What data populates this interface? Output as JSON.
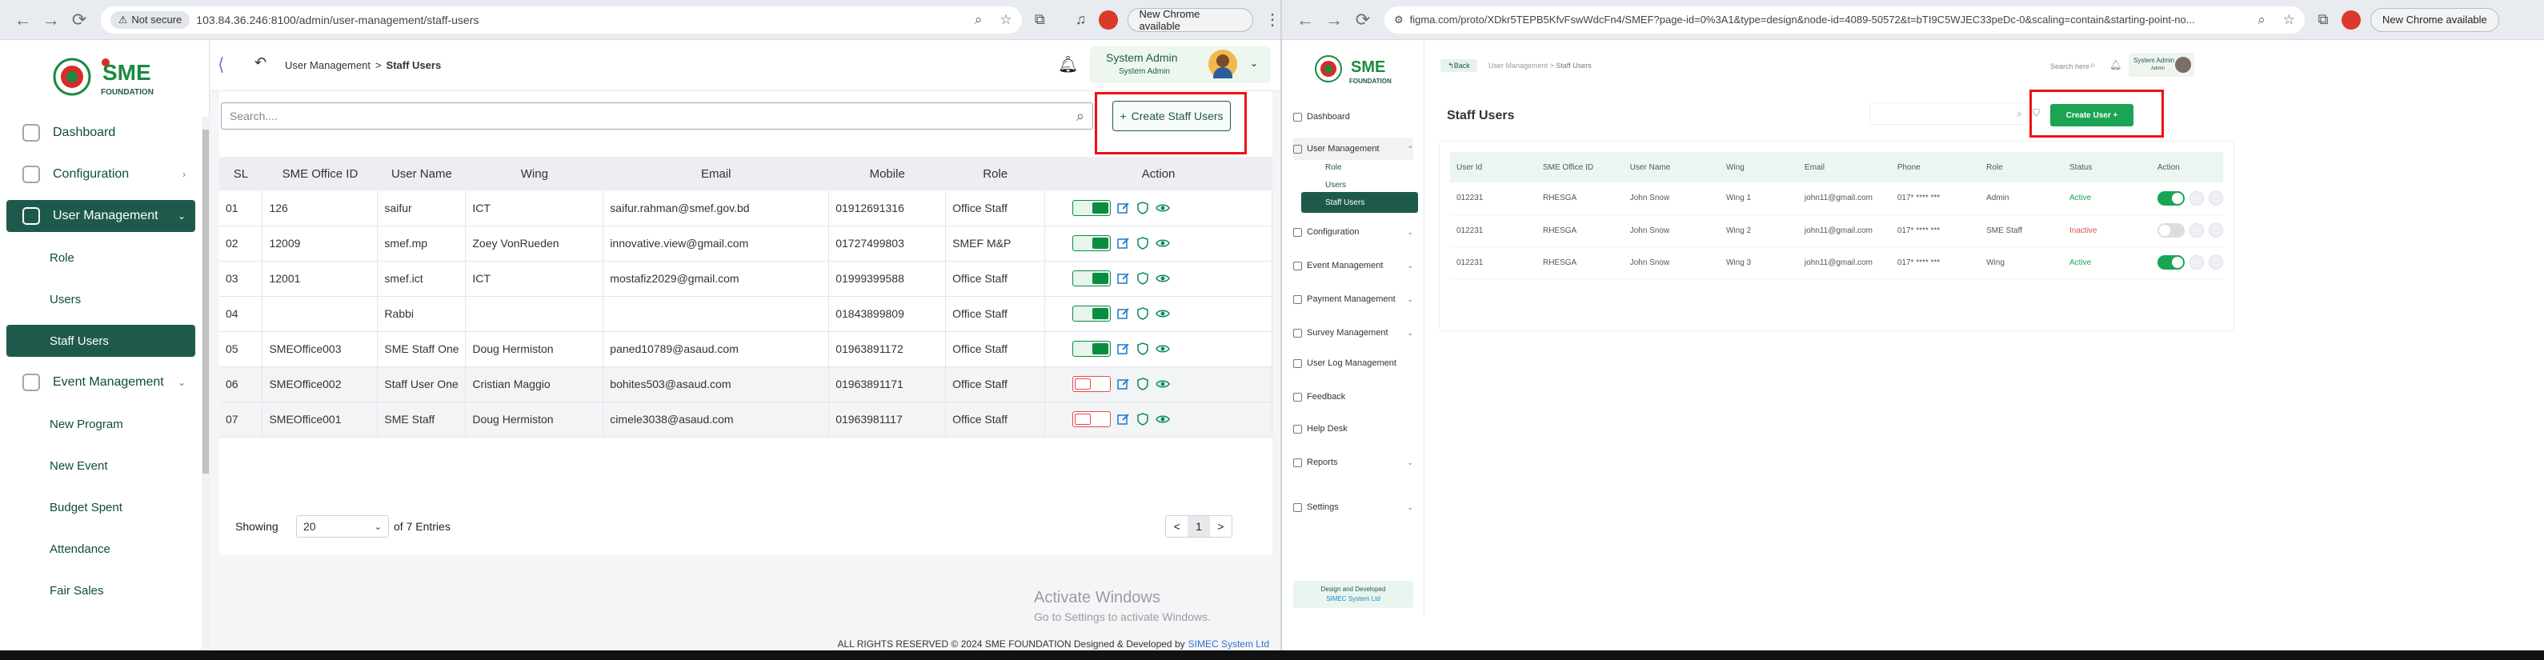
{
  "left_browser": {
    "not_secure": "Not secure",
    "url": "103.84.36.246:8100/admin/user-management/staff-users",
    "update_button": "New Chrome available"
  },
  "right_browser": {
    "url": "figma.com/proto/XDkr5TEPB5KfvFswWdcFn4/SMEF?page-id=0%3A1&type=design&node-id=4089-50572&t=bTI9C5WJEC33peDc-0&scaling=contain&starting-point-no...",
    "update_button": "New Chrome available"
  },
  "app": {
    "logo_text": "SME",
    "logo_sub": "FOUNDATION",
    "breadcrumb": {
      "parent": "User Management",
      "sep": ">",
      "current": "Staff Users"
    },
    "user": {
      "name": "System Admin",
      "role": "System Admin"
    },
    "sidebar": [
      {
        "label": "Dashboard",
        "type": "item"
      },
      {
        "label": "Configuration",
        "type": "item",
        "chevron": "›"
      },
      {
        "label": "User Management",
        "type": "item",
        "chevron": "⌄",
        "active": true
      },
      {
        "label": "Role",
        "type": "sub"
      },
      {
        "label": "Users",
        "type": "sub"
      },
      {
        "label": "Staff Users",
        "type": "sub",
        "active": true
      },
      {
        "label": "Event Management",
        "type": "item",
        "chevron": "⌄"
      },
      {
        "label": "New Program",
        "type": "sub"
      },
      {
        "label": "New Event",
        "type": "sub"
      },
      {
        "label": "Budget Spent",
        "type": "sub"
      },
      {
        "label": "Attendance",
        "type": "sub"
      },
      {
        "label": "Fair Sales",
        "type": "sub"
      }
    ],
    "search_placeholder": "Search....",
    "create_button": "Create Staff Users",
    "table": {
      "headers": [
        "SL",
        "SME Office ID",
        "User Name",
        "Wing",
        "Email",
        "Mobile",
        "Role",
        "Action"
      ],
      "rows": [
        {
          "sl": "01",
          "office_id": "126",
          "user_name": "saifur",
          "wing": "ICT",
          "email": "saifur.rahman@smef.gov.bd",
          "mobile": "01912691316",
          "role": "Office Staff",
          "active": true
        },
        {
          "sl": "02",
          "office_id": "12009",
          "user_name": "smef.mp",
          "wing": "Zoey VonRueden",
          "email": "innovative.view@gmail.com",
          "mobile": "01727499803",
          "role": "SMEF M&P",
          "active": true
        },
        {
          "sl": "03",
          "office_id": "12001",
          "user_name": "smef.ict",
          "wing": "ICT",
          "email": "mostafiz2029@gmail.com",
          "mobile": "01999399588",
          "role": "Office Staff",
          "active": true
        },
        {
          "sl": "04",
          "office_id": "",
          "user_name": "Rabbi",
          "wing": "",
          "email": "",
          "mobile": "01843899809",
          "role": "Office Staff",
          "active": true
        },
        {
          "sl": "05",
          "office_id": "SMEOffice003",
          "user_name": "SME Staff One",
          "wing": "Doug Hermiston",
          "email": "paned10789@asaud.com",
          "mobile": "01963891172",
          "role": "Office Staff",
          "active": true
        },
        {
          "sl": "06",
          "office_id": "SMEOffice002",
          "user_name": "Staff User One",
          "wing": "Cristian Maggio",
          "email": "bohites503@asaud.com",
          "mobile": "01963891171",
          "role": "Office Staff",
          "active": false
        },
        {
          "sl": "07",
          "office_id": "SMEOffice001",
          "user_name": "SME Staff",
          "wing": "Doug Hermiston",
          "email": "cimele3038@asaud.com",
          "mobile": "01963981117",
          "role": "Office Staff",
          "active": false
        }
      ]
    },
    "pagination": {
      "showing": "Showing",
      "page_size": "20",
      "of_entries": "of 7 Entries",
      "prev": "<",
      "page": "1",
      "next": ">"
    },
    "footer": {
      "text": "ALL RIGHTS RESERVED © 2024 SME FOUNDATION   Designed & Developed by",
      "company": "SIMEC System Ltd"
    },
    "watermark": {
      "title": "Activate Windows",
      "sub": "Go to Settings to activate Windows."
    }
  },
  "figma": {
    "back": "Back",
    "breadcrumb": {
      "parent": "User Management",
      "sep": ">",
      "current": "Staff Users"
    },
    "search": "Search here",
    "user": {
      "name": "System Admin",
      "role": "Admin"
    },
    "page_title": "Staff Users",
    "create_button": "Create User +",
    "sidebar": [
      {
        "label": "Dashboard",
        "type": "item"
      },
      {
        "label": "User Management",
        "type": "item",
        "chevron": "⌃"
      },
      {
        "label": "Role",
        "type": "sub"
      },
      {
        "label": "Users",
        "type": "sub"
      },
      {
        "label": "Staff Users",
        "type": "sub",
        "active": true
      },
      {
        "label": "Configuration",
        "type": "item",
        "chevron": "⌄"
      },
      {
        "label": "Event Management",
        "type": "item",
        "chevron": "⌄"
      },
      {
        "label": "Payment Management",
        "type": "item",
        "chevron": "⌄"
      },
      {
        "label": "Survey Management",
        "type": "item",
        "chevron": "⌄"
      },
      {
        "label": "User Log Management",
        "type": "item"
      },
      {
        "label": "Feedback",
        "type": "item"
      },
      {
        "label": "Help Desk",
        "type": "item"
      },
      {
        "label": "Reports",
        "type": "item",
        "chevron": "⌄"
      },
      {
        "label": "Settings",
        "type": "item",
        "chevron": "⌄"
      }
    ],
    "sidebar_footer": {
      "line1": "Design and Developed",
      "line2": "SIMEC System Ltd"
    },
    "table": {
      "headers": [
        "User Id",
        "SME Office ID",
        "User Name",
        "Wing",
        "Email",
        "Phone",
        "Role",
        "Status",
        "Action"
      ],
      "rows": [
        {
          "id": "012231",
          "office": "RHESGA",
          "name": "John Snow",
          "wing": "Wing 1",
          "email": "john11@gmail.com",
          "phone": "017* **** ***",
          "role": "Admin",
          "status": "Active",
          "active": true
        },
        {
          "id": "012231",
          "office": "RHESGA",
          "name": "John Snow",
          "wing": "Wing 2",
          "email": "john11@gmail.com",
          "phone": "017* **** ***",
          "role": "SME Staff",
          "status": "Inactive",
          "active": false
        },
        {
          "id": "012231",
          "office": "RHESGA",
          "name": "John Snow",
          "wing": "Wing 3",
          "email": "john11@gmail.com",
          "phone": "017* **** ***",
          "role": "Wing",
          "status": "Active",
          "active": true
        }
      ]
    }
  },
  "colors": {
    "brand": "#1e5a4c",
    "active_green": "#0b8c3f",
    "inactive_red": "#e24d4d",
    "highlight": "#e11111",
    "figma_green": "#1aa454"
  }
}
